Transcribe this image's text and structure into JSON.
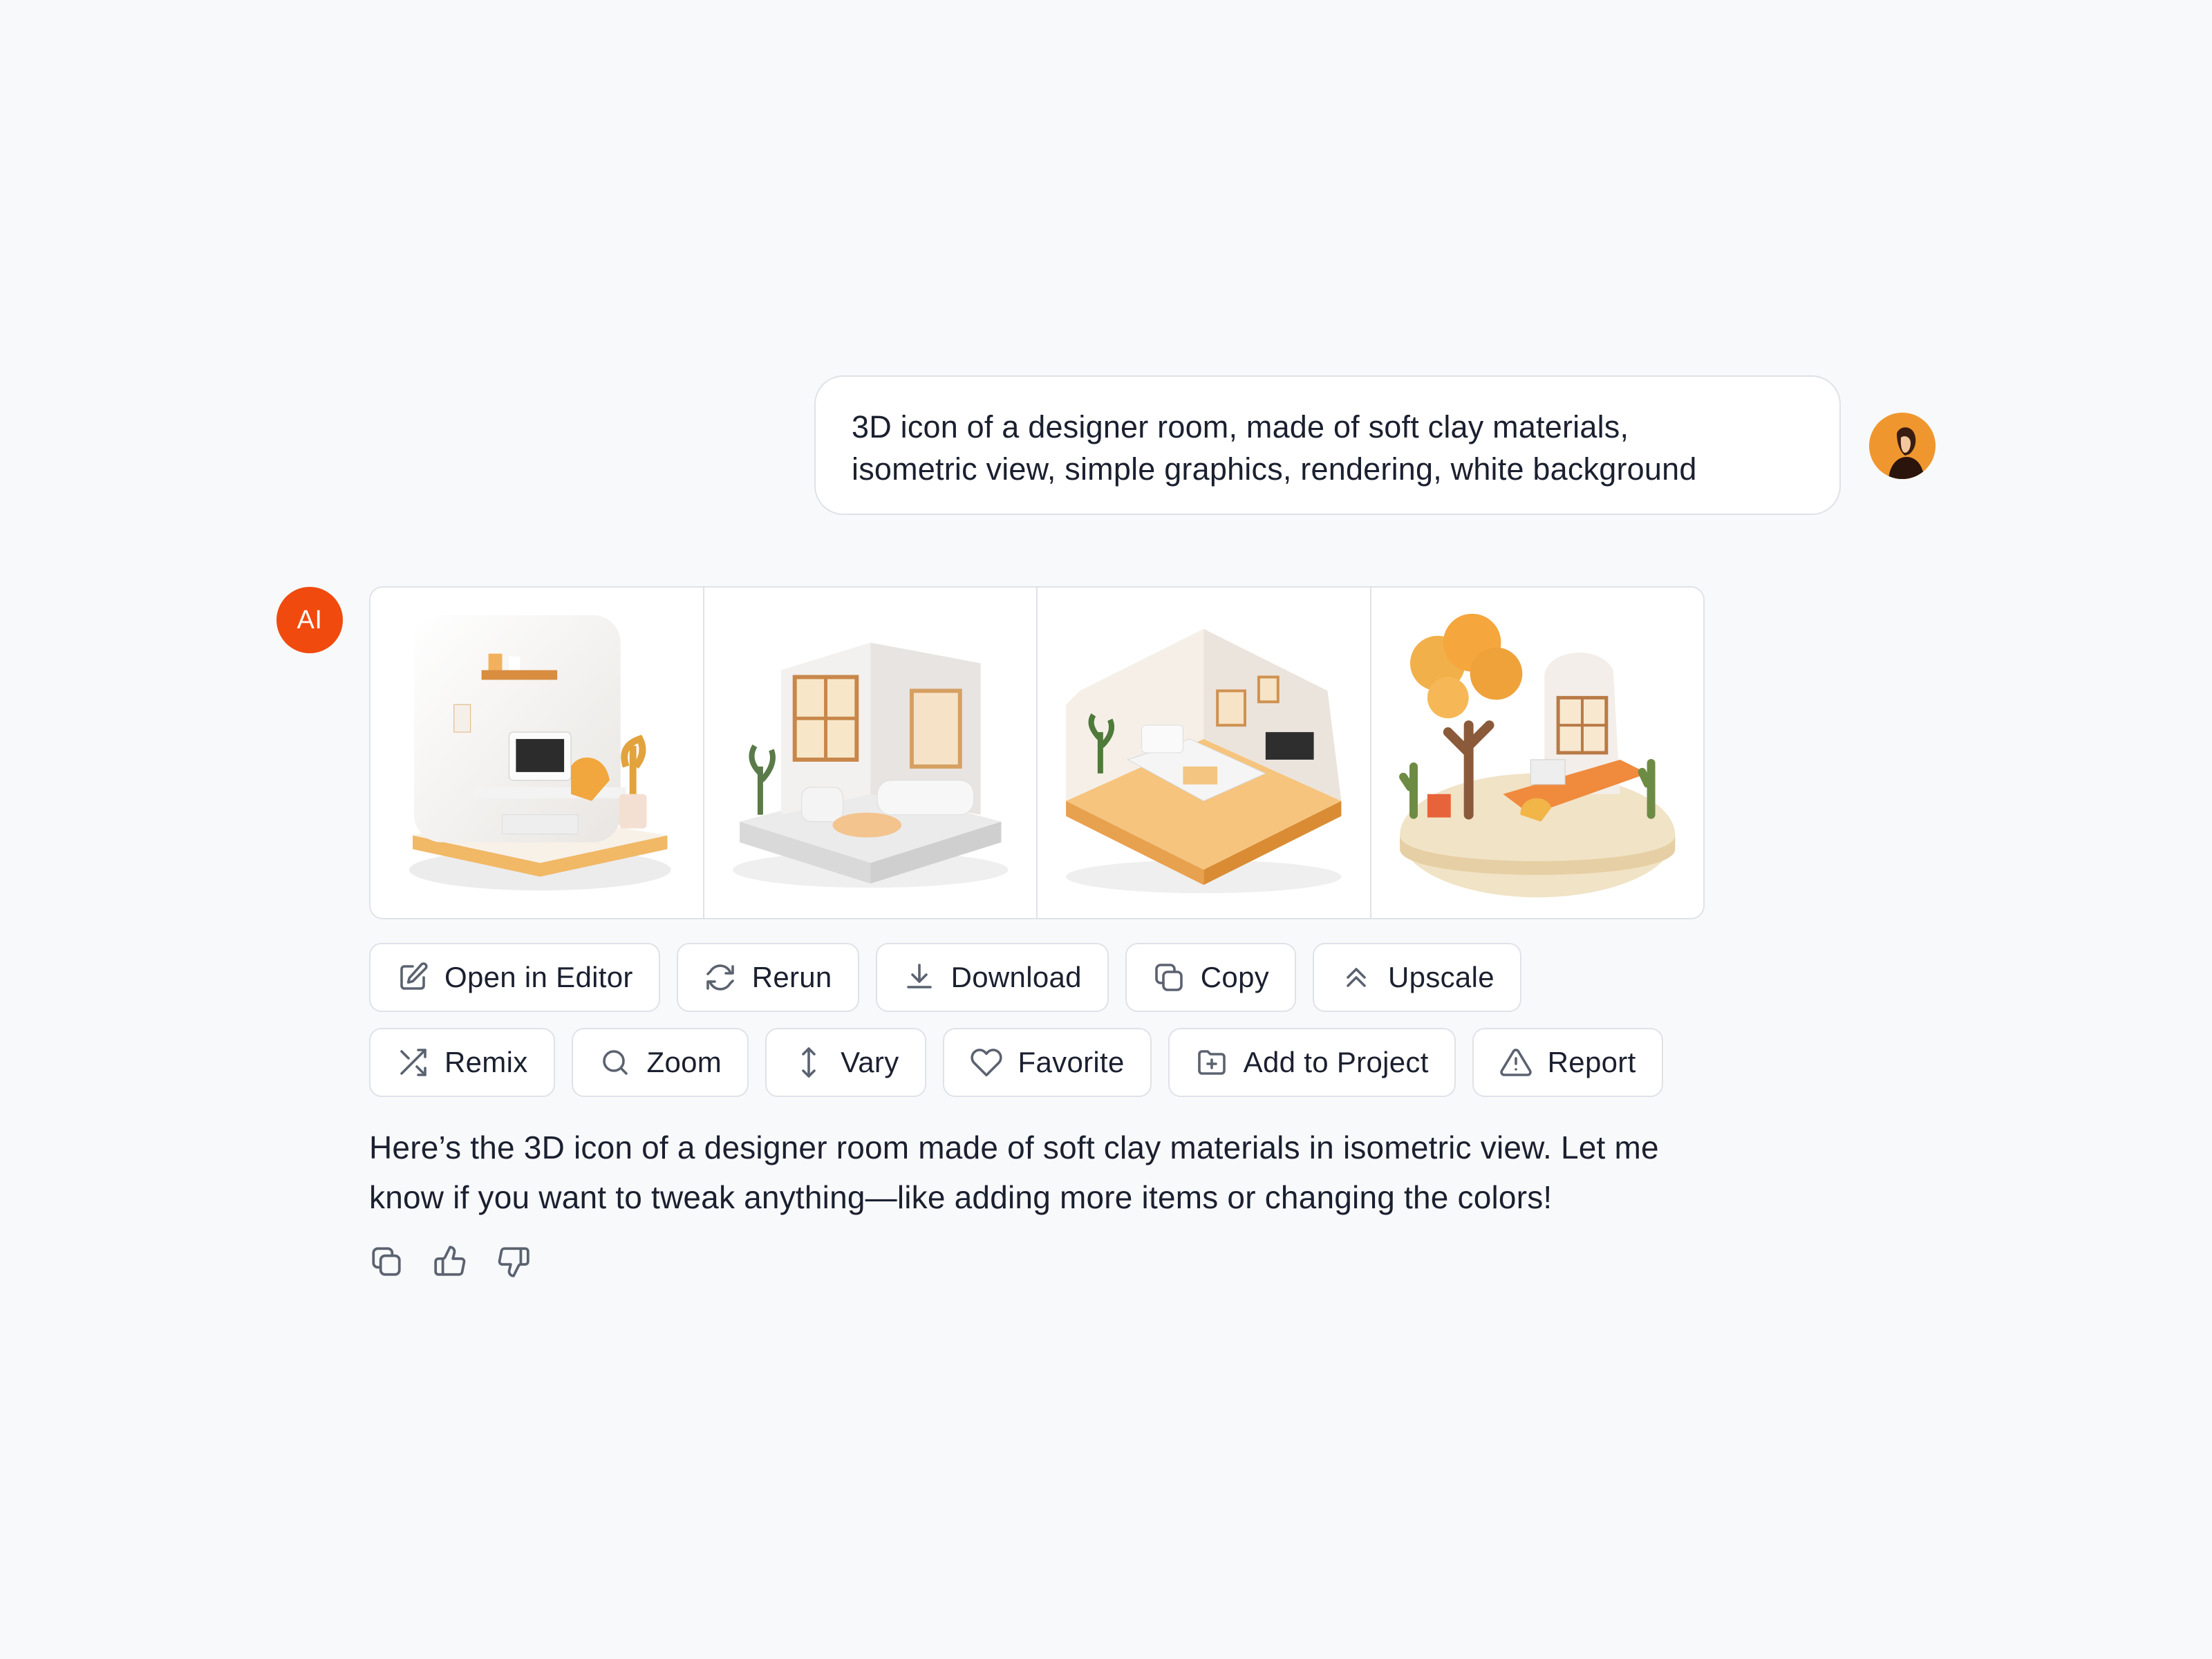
{
  "user_message": {
    "lines": [
      "3D icon of a designer room, made of soft clay materials,",
      "isometric view, simple graphics, rendering, white background"
    ]
  },
  "ai": {
    "avatar_label": "AI",
    "images": [
      {
        "name": "designer room 1"
      },
      {
        "name": "designer room 2"
      },
      {
        "name": "designer room 3"
      },
      {
        "name": "designer room 4"
      }
    ],
    "actions_row1": [
      {
        "label": "Open in Editor",
        "icon": "edit-icon"
      },
      {
        "label": "Rerun",
        "icon": "refresh-icon"
      },
      {
        "label": "Download",
        "icon": "download-icon"
      },
      {
        "label": "Copy",
        "icon": "copy-icon"
      },
      {
        "label": "Upscale",
        "icon": "chevrons-up-icon"
      }
    ],
    "actions_row2": [
      {
        "label": "Remix",
        "icon": "shuffle-icon"
      },
      {
        "label": "Zoom",
        "icon": "search-icon"
      },
      {
        "label": "Vary",
        "icon": "vertical-arrows-icon"
      },
      {
        "label": "Favorite",
        "icon": "heart-icon"
      },
      {
        "label": "Add to Project",
        "icon": "folder-plus-icon"
      },
      {
        "label": "Report",
        "icon": "warning-icon"
      }
    ],
    "response_lines": [
      "Here’s the 3D icon of a designer room made of soft clay materials in isometric view. Let me",
      "know if you want to tweak anything—like adding more items or changing the colors!"
    ],
    "feedback": [
      "copy-icon",
      "thumbs-up-icon",
      "thumbs-down-icon"
    ]
  },
  "colors": {
    "background": "#f8f9fb",
    "ai_avatar": "#f04a0f",
    "border": "#dfe2e7",
    "text": "#1b2030",
    "icon": "#5b6270"
  }
}
